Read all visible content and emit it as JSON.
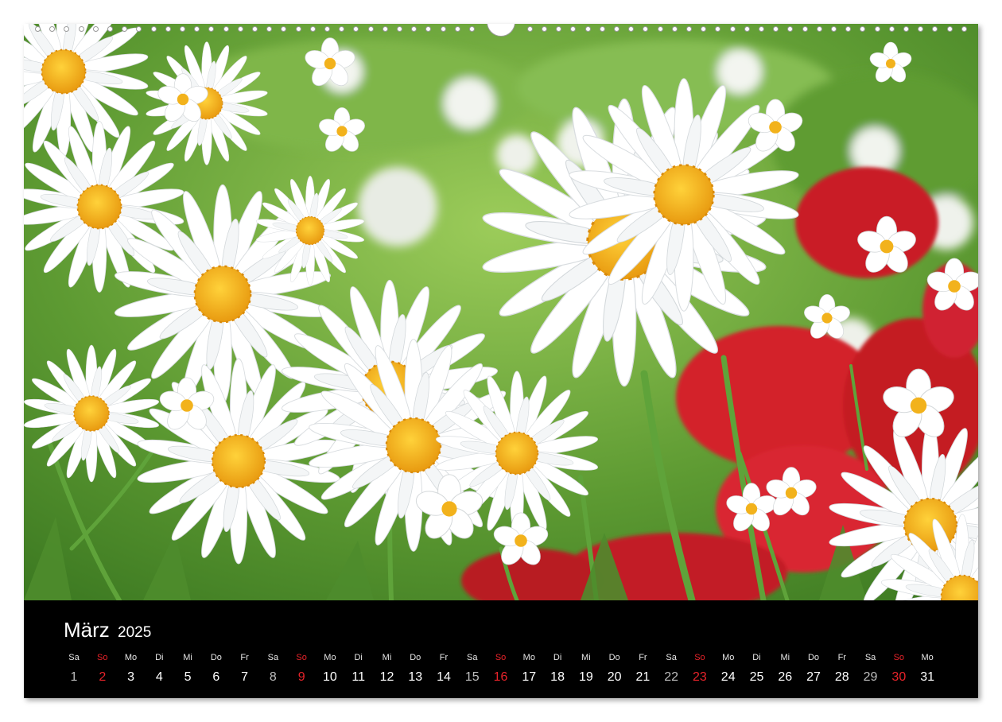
{
  "calendar": {
    "month": "März",
    "year": "2025",
    "days": [
      {
        "wd": "Sa",
        "d": "1",
        "type": "sat"
      },
      {
        "wd": "So",
        "d": "2",
        "type": "sun"
      },
      {
        "wd": "Mo",
        "d": "3",
        "type": "week"
      },
      {
        "wd": "Di",
        "d": "4",
        "type": "week"
      },
      {
        "wd": "Mi",
        "d": "5",
        "type": "week"
      },
      {
        "wd": "Do",
        "d": "6",
        "type": "week"
      },
      {
        "wd": "Fr",
        "d": "7",
        "type": "week"
      },
      {
        "wd": "Sa",
        "d": "8",
        "type": "sat"
      },
      {
        "wd": "So",
        "d": "9",
        "type": "sun"
      },
      {
        "wd": "Mo",
        "d": "10",
        "type": "week"
      },
      {
        "wd": "Di",
        "d": "11",
        "type": "week"
      },
      {
        "wd": "Mi",
        "d": "12",
        "type": "week"
      },
      {
        "wd": "Do",
        "d": "13",
        "type": "week"
      },
      {
        "wd": "Fr",
        "d": "14",
        "type": "week"
      },
      {
        "wd": "Sa",
        "d": "15",
        "type": "sat"
      },
      {
        "wd": "So",
        "d": "16",
        "type": "sun"
      },
      {
        "wd": "Mo",
        "d": "17",
        "type": "week"
      },
      {
        "wd": "Di",
        "d": "18",
        "type": "week"
      },
      {
        "wd": "Mi",
        "d": "19",
        "type": "week"
      },
      {
        "wd": "Do",
        "d": "20",
        "type": "week"
      },
      {
        "wd": "Fr",
        "d": "21",
        "type": "week"
      },
      {
        "wd": "Sa",
        "d": "22",
        "type": "sat"
      },
      {
        "wd": "So",
        "d": "23",
        "type": "sun"
      },
      {
        "wd": "Mo",
        "d": "24",
        "type": "week"
      },
      {
        "wd": "Di",
        "d": "25",
        "type": "week"
      },
      {
        "wd": "Mi",
        "d": "26",
        "type": "week"
      },
      {
        "wd": "Do",
        "d": "27",
        "type": "week"
      },
      {
        "wd": "Fr",
        "d": "28",
        "type": "week"
      },
      {
        "wd": "Sa",
        "d": "29",
        "type": "sat"
      },
      {
        "wd": "So",
        "d": "30",
        "type": "sun"
      },
      {
        "wd": "Mo",
        "d": "31",
        "type": "week"
      }
    ]
  },
  "colors": {
    "sunday": "#e8232a",
    "strip_background": "#000000",
    "petal": "#ffffff",
    "flower_center": "#f2b21c",
    "red_flowers": "#d3202a",
    "foliage": "#5f9c33"
  },
  "photo": {
    "subject": "white-daisies-with-red-flowers"
  }
}
